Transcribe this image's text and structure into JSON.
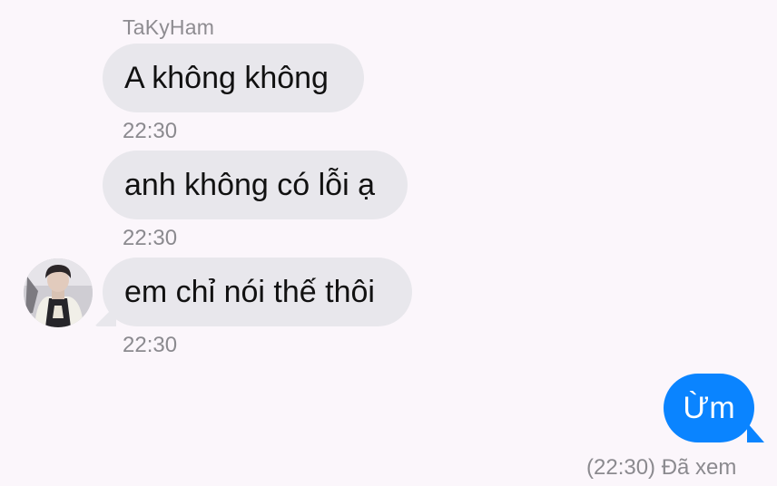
{
  "conversation": {
    "sender_name": "TaKyHam",
    "messages": [
      {
        "direction": "incoming",
        "text": "A không không",
        "time": "22:30"
      },
      {
        "direction": "incoming",
        "text": "anh không có lỗi ạ",
        "time": "22:30"
      },
      {
        "direction": "incoming",
        "text": "em chỉ nói thế thôi",
        "time": "22:30"
      },
      {
        "direction": "outgoing",
        "text": "Ừm",
        "status": "(22:30) Đã xem"
      }
    ]
  },
  "colors": {
    "background": "#fbf6fb",
    "incoming_bubble": "#e8e7ec",
    "outgoing_bubble": "#0a84ff",
    "meta_text": "#8b8a8f"
  }
}
